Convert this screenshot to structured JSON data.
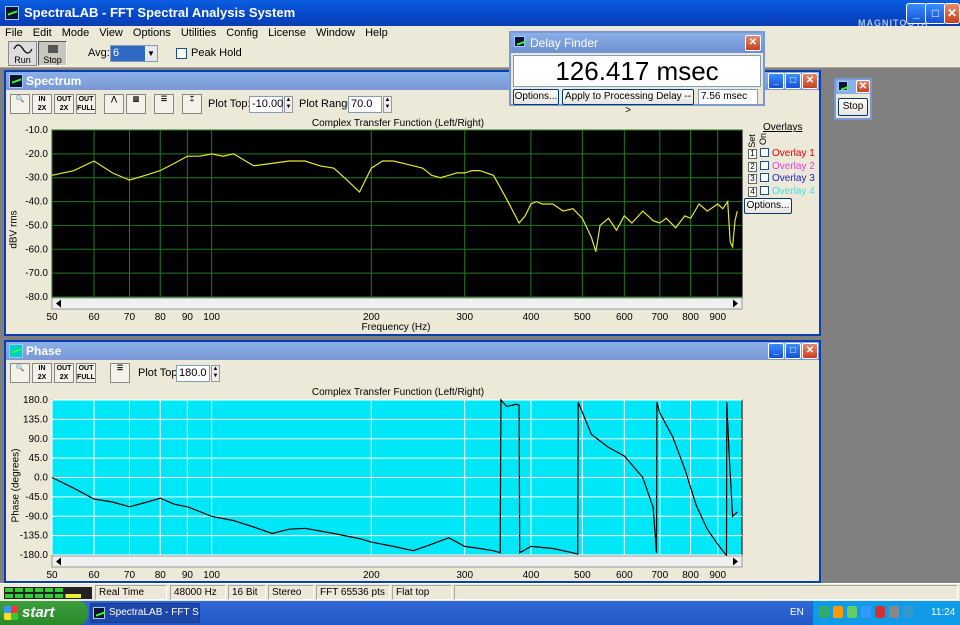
{
  "app": {
    "title": "SpectraLAB - FFT Spectral Analysis System",
    "menu": [
      "File",
      "Edit",
      "Mode",
      "View",
      "Options",
      "Utilities",
      "Config",
      "License",
      "Window",
      "Help"
    ],
    "watermark": "MAGNITOOTA CarAudio Team"
  },
  "toolbar": {
    "run_label": "Run",
    "stop_label": "Stop",
    "avg_label": "Avg:",
    "avg_value": "6",
    "peak_hold_label": "Peak Hold"
  },
  "spectrum": {
    "title": "Spectrum",
    "plot_top_label": "Plot Top:",
    "plot_top_value": "-10.00",
    "plot_range_label": "Plot Range:",
    "plot_range_value": "70.0",
    "chart_title": "Complex Transfer Function (Left/Right)",
    "ylabel": "dBV rms",
    "xlabel": "Frequency (Hz)",
    "overlays_label": "Overlays",
    "set_label": "Set",
    "on_label": "On",
    "overlays": [
      {
        "num": "1",
        "label": "Overlay 1",
        "color": "#e00000"
      },
      {
        "num": "2",
        "label": "Overlay 2",
        "color": "#e040e0"
      },
      {
        "num": "3",
        "label": "Overlay 3",
        "color": "#2020c0"
      },
      {
        "num": "4",
        "label": "Overlay 4",
        "color": "#40e0e0"
      }
    ],
    "options_label": "Options..."
  },
  "phase": {
    "title": "Phase",
    "plot_top_label": "Plot Top:",
    "plot_top_value": "180.0",
    "chart_title": "Complex Transfer Function (Left/Right)",
    "ylabel": "Phase (degrees)"
  },
  "delay_finder": {
    "title": "Delay Finder",
    "value": "126.417 msec",
    "options_label": "Options...",
    "apply_label": "Apply to Processing Delay -->",
    "delay_value": "7.56 msec"
  },
  "mini_window": {
    "stop_label": "Stop"
  },
  "statusbar": {
    "mode": "Real Time",
    "rate": "48000 Hz",
    "bits": "16 Bit",
    "channels": "Stereo",
    "fft": "FFT 65536 pts",
    "window": "Flat top"
  },
  "taskbar": {
    "start_label": "start",
    "task_label": "SpectraLAB - FFT Spe...",
    "lang": "EN",
    "clock": "11:24"
  },
  "chart_data": [
    {
      "type": "line",
      "title": "Complex Transfer Function (Left/Right)",
      "xlabel": "Frequency (Hz)",
      "ylabel": "dBV rms",
      "xscale": "log",
      "xlim": [
        50,
        1000
      ],
      "ylim": [
        -80,
        -10
      ],
      "grid": true,
      "background": "#000000",
      "line_color": "#e6e630",
      "x_ticks": [
        50,
        60,
        70,
        80,
        90,
        100,
        200,
        300,
        400,
        500,
        600,
        700,
        800,
        900
      ],
      "y_ticks": [
        "-10.0",
        "-20.0",
        "-30.0",
        "-40.0",
        "-50.0",
        "-60.0",
        "-70.0",
        "-80.0"
      ],
      "x": [
        50,
        55,
        60,
        65,
        70,
        75,
        80,
        85,
        90,
        95,
        100,
        105,
        110,
        120,
        130,
        140,
        150,
        160,
        170,
        180,
        190,
        200,
        210,
        220,
        230,
        240,
        250,
        260,
        270,
        280,
        290,
        300,
        310,
        320,
        340,
        360,
        380,
        390,
        400,
        410,
        420,
        440,
        460,
        480,
        500,
        520,
        530,
        540,
        560,
        580,
        600,
        620,
        650,
        680,
        700,
        720,
        750,
        780,
        800,
        830,
        860,
        900,
        920,
        940,
        950,
        960,
        970,
        980
      ],
      "y": [
        -29,
        -27,
        -23,
        -28,
        -31,
        -29,
        -27,
        -24,
        -21,
        -21,
        -20,
        -21,
        -20,
        -25,
        -24,
        -23,
        -23,
        -25,
        -26,
        -31,
        -36,
        -26,
        -23,
        -23,
        -24,
        -25,
        -26,
        -29,
        -30,
        -29,
        -28,
        -28,
        -27,
        -27,
        -29,
        -39,
        -49,
        -46,
        -41,
        -40,
        -41,
        -41,
        -44,
        -43,
        -47,
        -55,
        -61,
        -50,
        -47,
        -52,
        -46,
        -49,
        -44,
        -48,
        -49,
        -47,
        -51,
        -46,
        -47,
        -41,
        -44,
        -41,
        -43,
        -40,
        -57,
        -59,
        -48,
        -44
      ]
    },
    {
      "type": "line",
      "title": "Complex Transfer Function (Left/Right)",
      "xlabel": "",
      "ylabel": "Phase (degrees)",
      "xscale": "log",
      "xlim": [
        50,
        1000
      ],
      "ylim": [
        -180,
        180
      ],
      "grid": true,
      "background": "#00e8f8",
      "line_color": "#000000",
      "x_ticks": [
        50,
        60,
        70,
        80,
        90,
        100,
        200,
        300,
        400,
        500,
        600,
        700,
        800,
        900
      ],
      "y_ticks": [
        "180.0",
        "135.0",
        "90.0",
        "45.0",
        "0.0",
        "-45.0",
        "-90.0",
        "-135.0",
        "-180.0"
      ],
      "x": [
        50,
        55,
        60,
        65,
        70,
        75,
        80,
        85,
        90,
        100,
        110,
        120,
        130,
        140,
        150,
        170,
        190,
        200,
        220,
        240,
        260,
        280,
        300,
        320,
        340,
        350,
        351,
        360,
        375,
        380,
        381,
        400,
        440,
        480,
        490,
        491,
        520,
        560,
        600,
        650,
        680,
        690,
        691,
        700,
        740,
        780,
        820,
        860,
        900,
        930,
        935,
        936,
        945,
        960,
        980
      ],
      "y": [
        0,
        -25,
        -50,
        -57,
        -68,
        -58,
        -48,
        -62,
        -68,
        -90,
        -100,
        -115,
        -130,
        -120,
        -118,
        -130,
        -142,
        -150,
        -160,
        -170,
        -155,
        -140,
        -160,
        -165,
        -170,
        -175,
        180,
        165,
        170,
        168,
        -175,
        -160,
        -165,
        -175,
        -178,
        175,
        100,
        70,
        50,
        0,
        -70,
        -175,
        175,
        150,
        95,
        20,
        -65,
        -120,
        -155,
        -178,
        -180,
        175,
        60,
        -90,
        -80
      ]
    }
  ]
}
